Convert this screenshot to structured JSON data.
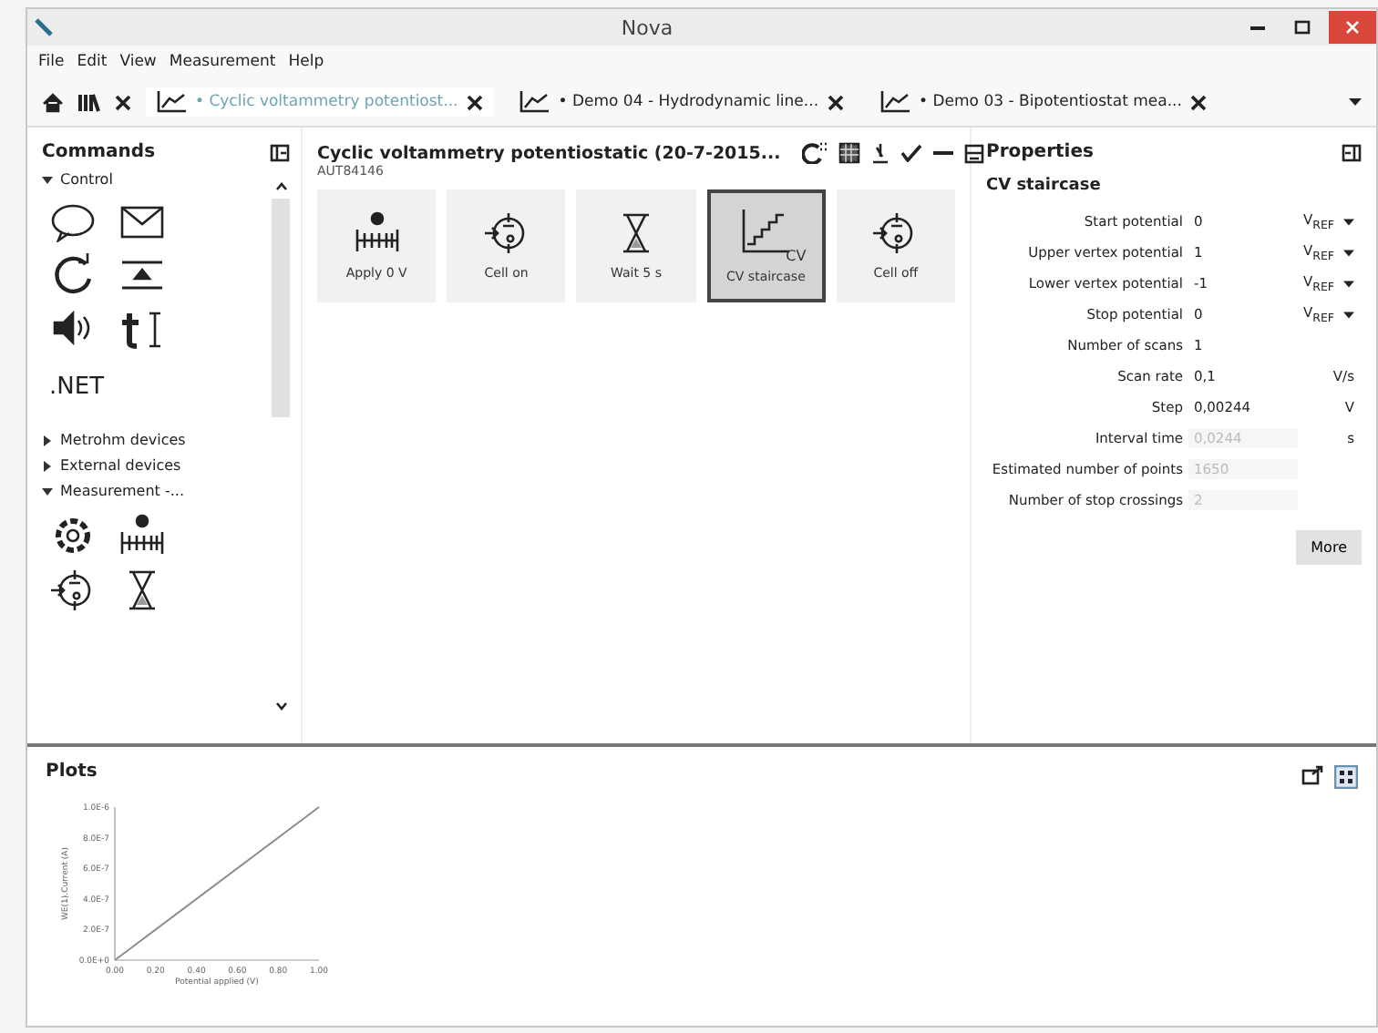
{
  "window": {
    "title": "Nova"
  },
  "menu": [
    "File",
    "Edit",
    "View",
    "Measurement",
    "Help"
  ],
  "tabs": [
    {
      "label": "• Cyclic voltammetry potentiost...",
      "selected": true
    },
    {
      "label": "• Demo 04 - Hydrodynamic line...",
      "selected": false
    },
    {
      "label": "• Demo 03 - Bipotentiostat mea...",
      "selected": false
    }
  ],
  "commands": {
    "title": "Commands",
    "groups": [
      {
        "label": "Control",
        "expanded": true,
        "text_items": [
          ".NET"
        ]
      },
      {
        "label": "Metrohm devices",
        "expanded": false
      },
      {
        "label": "External devices",
        "expanded": false
      },
      {
        "label": "Measurement -...",
        "expanded": true
      }
    ]
  },
  "procedure": {
    "title": "Cyclic voltammetry potentiostatic (20-7-2015...",
    "instrument": "AUT84146",
    "steps": [
      {
        "label": "Apply 0 V",
        "selected": false
      },
      {
        "label": "Cell on",
        "selected": false
      },
      {
        "label": "Wait 5 s",
        "selected": false
      },
      {
        "label": "CV staircase",
        "selected": true,
        "icon_text": "CV"
      },
      {
        "label": "Cell off",
        "selected": false
      }
    ]
  },
  "properties": {
    "title": "Properties",
    "section": "CV staircase",
    "rows": [
      {
        "label": "Start potential",
        "value": "0",
        "unit": "V$_{REF}$",
        "dropdown": true,
        "disabled": false
      },
      {
        "label": "Upper vertex potential",
        "value": "1",
        "unit": "V$_{REF}$",
        "dropdown": true,
        "disabled": false
      },
      {
        "label": "Lower vertex potential",
        "value": "-1",
        "unit": "V$_{REF}$",
        "dropdown": true,
        "disabled": false
      },
      {
        "label": "Stop potential",
        "value": "0",
        "unit": "V$_{REF}$",
        "dropdown": true,
        "disabled": false
      },
      {
        "label": "Number of scans",
        "value": "1",
        "dropdown": false,
        "disabled": false
      },
      {
        "label": "Scan rate",
        "value": "0,1",
        "unit": "V/s",
        "dropdown": false,
        "disabled": false
      },
      {
        "label": "Step",
        "value": "0,00244",
        "unit": "V",
        "dropdown": false,
        "disabled": false
      },
      {
        "label": "Interval time",
        "value": "0,0244",
        "unit": "s",
        "dropdown": false,
        "disabled": true
      },
      {
        "label": "Estimated number of points",
        "value": "1650",
        "dropdown": false,
        "disabled": true
      },
      {
        "label": "Number of stop crossings",
        "value": "2",
        "dropdown": false,
        "disabled": true
      }
    ],
    "more_button": "More"
  },
  "plots": {
    "title": "Plots",
    "chart_data": {
      "type": "line",
      "xlabel": "Potential applied (V)",
      "ylabel": "WE(1).Current (A)",
      "x": [
        0,
        1
      ],
      "series": [
        {
          "color": "#8c8c8c",
          "values": [
            0,
            1e-06
          ]
        }
      ],
      "xlim": [
        0,
        1
      ],
      "ylim": [
        0,
        1e-06
      ],
      "xticks": [
        {
          "value": 0,
          "label": "0.00"
        },
        {
          "value": 0.2,
          "label": "0.20"
        },
        {
          "value": 0.4,
          "label": "0.40"
        },
        {
          "value": 0.6,
          "label": "0.60"
        },
        {
          "value": 0.8,
          "label": "0.80"
        },
        {
          "value": 1,
          "label": "1.00"
        }
      ],
      "yticks": [
        {
          "value": 0,
          "label": "0.0E+0"
        },
        {
          "value": 2e-07,
          "label": "2.0E-7"
        },
        {
          "value": 4e-07,
          "label": "4.0E-7"
        },
        {
          "value": 6e-07,
          "label": "6.0E-7"
        },
        {
          "value": 8e-07,
          "label": "8.0E-7"
        },
        {
          "value": 1e-06,
          "label": "1.0E-6"
        }
      ]
    }
  }
}
